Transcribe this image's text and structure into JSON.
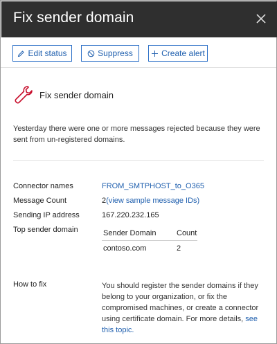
{
  "header": {
    "title": "Fix sender domain"
  },
  "toolbar": {
    "edit_status": "Edit status",
    "suppress": "Suppress",
    "create_alert": "Create alert"
  },
  "section": {
    "title": "Fix sender domain",
    "description": "Yesterday there were one or more messages rejected because they were sent from un-registered domains.",
    "icon": "wrench-icon"
  },
  "details": {
    "connector_label": "Connector names",
    "connector_value": "FROM_SMTPHOST_to_O365",
    "message_count_label": "Message Count",
    "message_count_value": "2",
    "message_count_link": "(view sample message IDs)",
    "sending_ip_label": "Sending IP address",
    "sending_ip_value": "167.220.232.165",
    "top_sender_label": "Top sender domain",
    "table": {
      "columns": [
        "Sender Domain",
        "Count"
      ],
      "rows": [
        [
          "contoso.com",
          "2"
        ]
      ]
    },
    "how_to_fix_label": "How to fix",
    "how_to_fix_text": "You should register the sender domains if they belong to your organization, or fix the compromised machines, or create a connector using certificate domain. For more details,",
    "how_to_fix_link": "see this topic."
  },
  "colors": {
    "header_bg": "#2f2f2f",
    "accent": "#1f5fae",
    "icon_red": "#c8102e"
  }
}
